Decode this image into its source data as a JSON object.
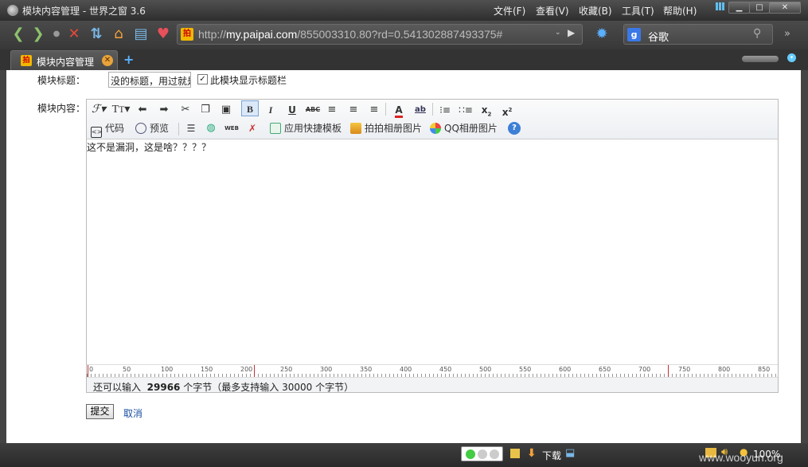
{
  "window": {
    "title": "模块内容管理 - 世界之窗 3.6",
    "menu": [
      "文件(F)",
      "查看(V)",
      "收藏(B)",
      "工具(T)",
      "帮助(H)"
    ]
  },
  "address": {
    "scheme": "http://",
    "host": "my.paipai.com",
    "path": "/855003310.80?rd=0.541302887493375#"
  },
  "search": {
    "engine": "谷歌"
  },
  "tabs": [
    {
      "title": "模块内容管理"
    }
  ],
  "form": {
    "title_label": "模块标题：",
    "title_value": "没的标题，用过就是。。",
    "show_title_label": "此模块显示标题栏",
    "content_label": "模块内容：",
    "submit_label": "提交",
    "cancel_label": "取消"
  },
  "editor": {
    "toolbar_row2": {
      "code": "代码",
      "preview": "预览",
      "quick_template": "应用快捷模板",
      "paipai_album": "拍拍相册图片",
      "qq_album": "QQ相册图片"
    },
    "content": "这不是漏洞，这是啥？？？？",
    "ruler_labels": [
      "0",
      "50",
      "100",
      "150",
      "200",
      "250",
      "300",
      "350",
      "400",
      "450",
      "500",
      "550",
      "600",
      "650",
      "700",
      "750",
      "800",
      "850"
    ],
    "count": {
      "prefix": "还可以输入",
      "remaining": "29966",
      "suffix": "个字节（最多支持输入",
      "max": "30000",
      "end": "个字节）"
    }
  },
  "status": {
    "download_label": "下载",
    "zoom": "100%",
    "watermark": "www.wooyun.org"
  },
  "colors": {
    "chrome_dark": "#3a3a3a",
    "link_blue": "#1a4fa0",
    "accent_blue": "#5ab0ff"
  }
}
